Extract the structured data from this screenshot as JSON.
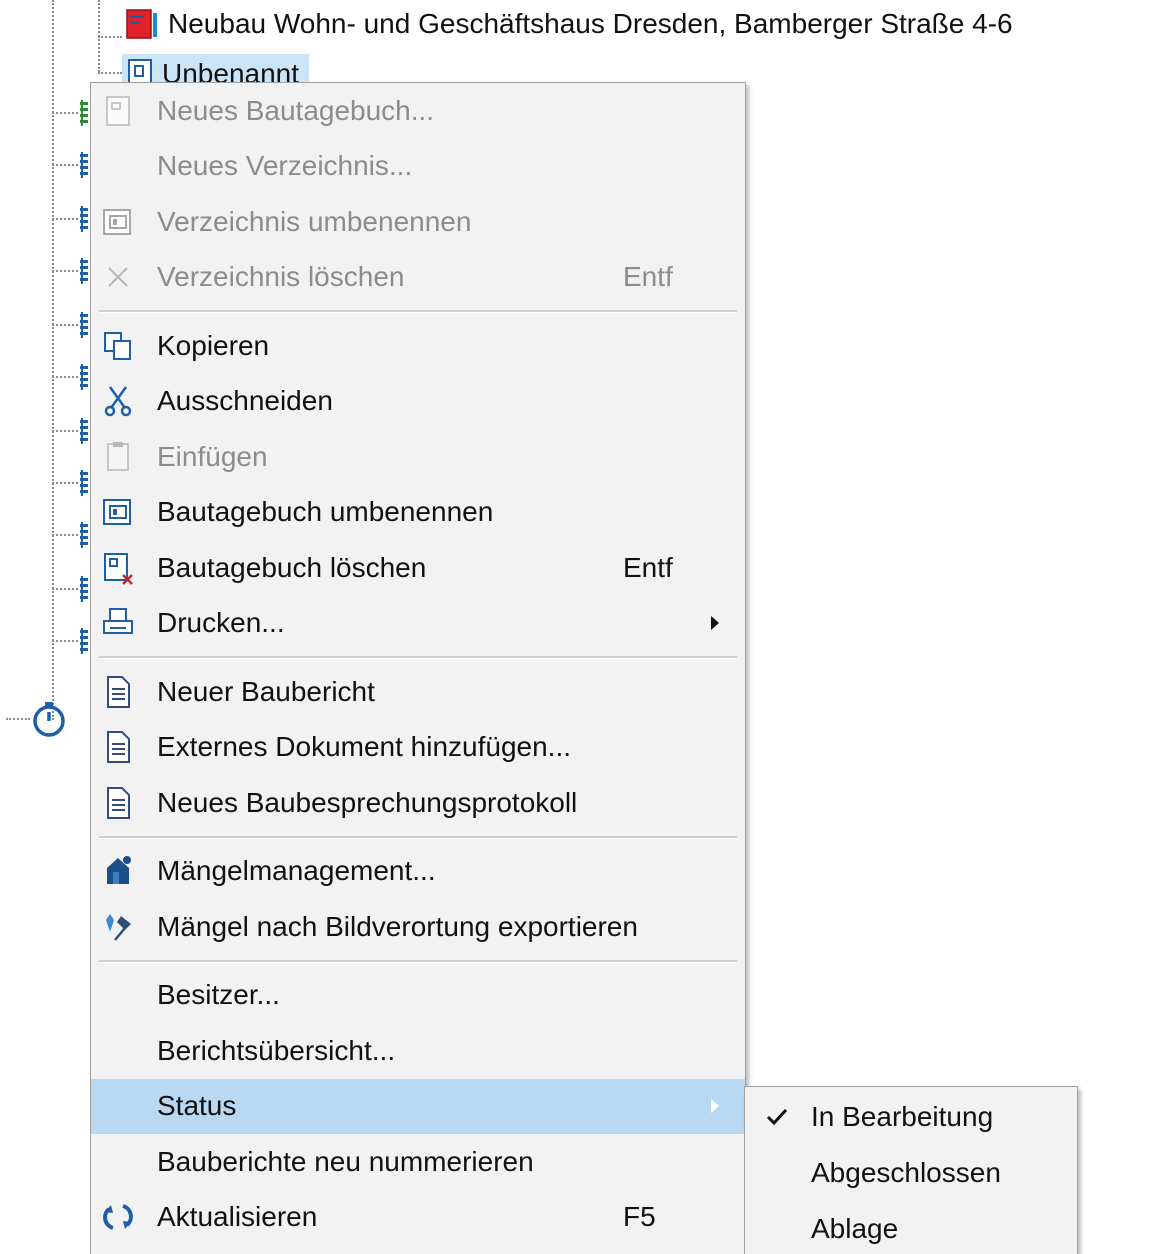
{
  "tree": {
    "project_label": "Neubau Wohn- und Geschäftshaus Dresden, Bamberger Straße 4-6",
    "selected_label": "Unbenannt"
  },
  "context_menu": {
    "items": [
      {
        "label": "Neues Bautagebuch...",
        "shortcut": "",
        "disabled": true,
        "icon": "new-diary-icon"
      },
      {
        "label": "Neues Verzeichnis...",
        "shortcut": "",
        "disabled": true,
        "icon": ""
      },
      {
        "label": "Verzeichnis umbenennen",
        "shortcut": "",
        "disabled": true,
        "icon": "rename-folder-icon"
      },
      {
        "label": "Verzeichnis löschen",
        "shortcut": "Entf",
        "disabled": true,
        "icon": "delete-x-icon"
      },
      {
        "label": "Kopieren",
        "shortcut": "",
        "disabled": false,
        "icon": "copy-icon"
      },
      {
        "label": "Ausschneiden",
        "shortcut": "",
        "disabled": false,
        "icon": "scissors-icon"
      },
      {
        "label": "Einfügen",
        "shortcut": "",
        "disabled": true,
        "icon": "paste-icon"
      },
      {
        "label": "Bautagebuch umbenennen",
        "shortcut": "",
        "disabled": false,
        "icon": "rename-diary-icon"
      },
      {
        "label": "Bautagebuch löschen",
        "shortcut": "Entf",
        "disabled": false,
        "icon": "delete-diary-icon"
      },
      {
        "label": "Drucken...",
        "shortcut": "",
        "disabled": false,
        "icon": "printer-icon",
        "submenu": true
      },
      {
        "label": "Neuer Baubericht",
        "shortcut": "",
        "disabled": false,
        "icon": "document-icon"
      },
      {
        "label": "Externes Dokument hinzufügen...",
        "shortcut": "",
        "disabled": false,
        "icon": "document-icon"
      },
      {
        "label": "Neues Baubesprechungsprotokoll",
        "shortcut": "",
        "disabled": false,
        "icon": "document-icon"
      },
      {
        "label": "Mängelmanagement...",
        "shortcut": "",
        "disabled": false,
        "icon": "defect-management-icon"
      },
      {
        "label": "Mängel nach Bildverortung exportieren",
        "shortcut": "",
        "disabled": false,
        "icon": "pin-export-icon"
      },
      {
        "label": "Besitzer...",
        "shortcut": "",
        "disabled": false,
        "icon": ""
      },
      {
        "label": "Berichtsübersicht...",
        "shortcut": "",
        "disabled": false,
        "icon": ""
      },
      {
        "label": "Status",
        "shortcut": "",
        "disabled": false,
        "icon": "",
        "submenu": true,
        "highlighted": true
      },
      {
        "label": "Bauberichte neu nummerieren",
        "shortcut": "",
        "disabled": false,
        "icon": ""
      },
      {
        "label": "Aktualisieren",
        "shortcut": "F5",
        "disabled": false,
        "icon": "refresh-icon"
      }
    ]
  },
  "status_submenu": {
    "items": [
      {
        "label": "In Bearbeitung",
        "checked": true
      },
      {
        "label": "Abgeschlossen",
        "checked": false
      },
      {
        "label": "Ablage",
        "checked": false
      }
    ]
  },
  "colors": {
    "menu_background": "#f2f2f2",
    "highlight": "#b9d9f3",
    "selection": "#cce4f7",
    "disabled_text": "#8c8c8c",
    "icon_blue": "#1e5fa8"
  }
}
